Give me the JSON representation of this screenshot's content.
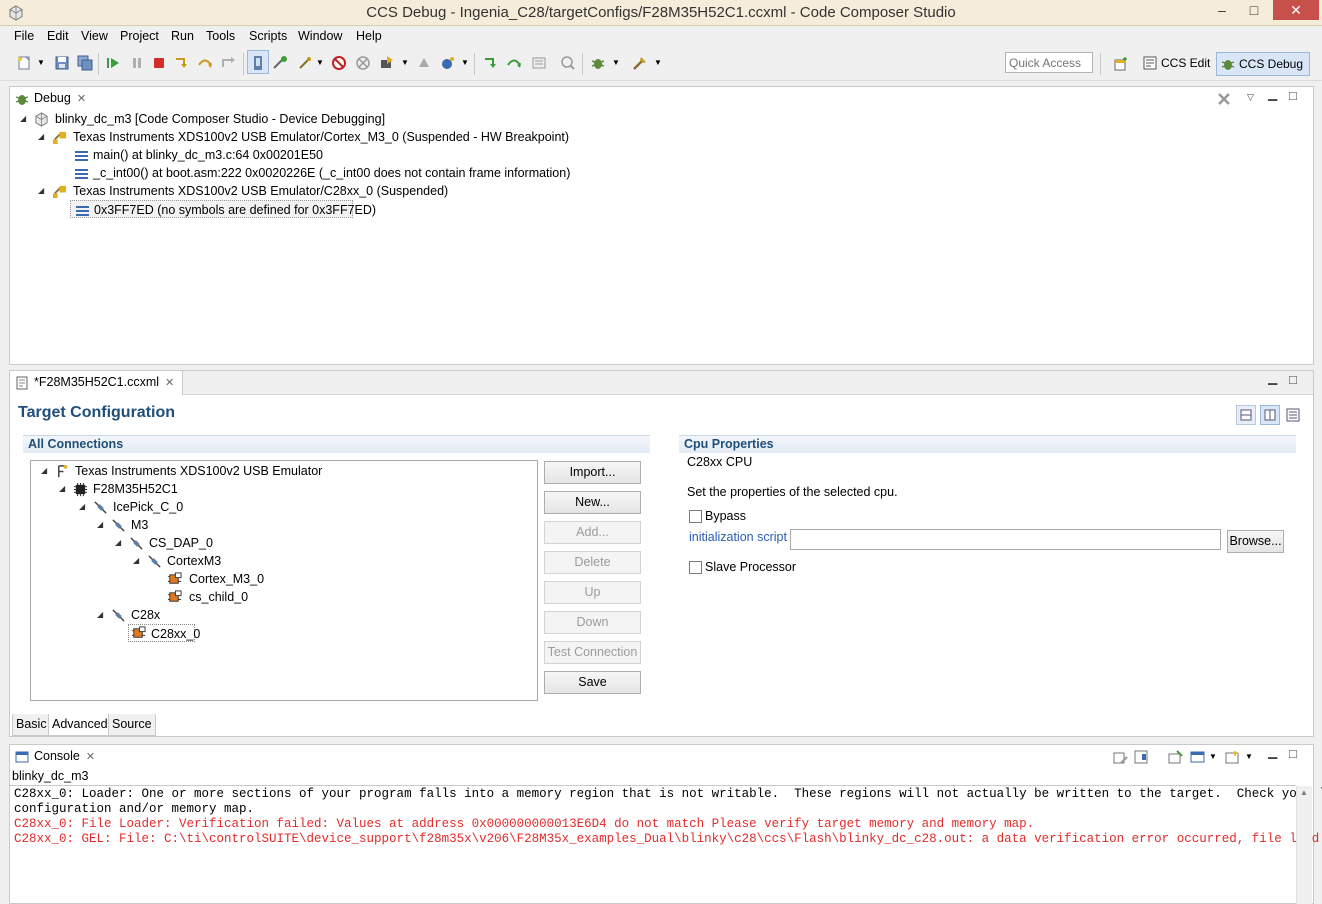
{
  "window": {
    "title": "CCS Debug - Ingenia_C28/targetConfigs/F28M35H52C1.ccxml - Code Composer Studio",
    "minimize": "–",
    "maximize": "□",
    "close": "✕"
  },
  "menu": [
    "File",
    "Edit",
    "View",
    "Project",
    "Run",
    "Tools",
    "Scripts",
    "Window",
    "Help"
  ],
  "toolbar": {
    "quick_access_placeholder": "Quick Access",
    "perspectives": [
      {
        "label": "CCS Edit",
        "active": false
      },
      {
        "label": "CCS Debug",
        "active": true
      }
    ]
  },
  "debug_view": {
    "tab_label": "Debug",
    "tree": [
      {
        "label": "blinky_dc_m3 [Code Composer Studio - Device Debugging]"
      },
      {
        "label": "Texas Instruments XDS100v2 USB Emulator/Cortex_M3_0 (Suspended - HW Breakpoint)"
      },
      {
        "label": "main() at blinky_dc_m3.c:64 0x00201E50"
      },
      {
        "label": "_c_int00() at boot.asm:222 0x0020226E  (_c_int00 does not contain frame information)"
      },
      {
        "label": "Texas Instruments XDS100v2 USB Emulator/C28xx_0 (Suspended)"
      },
      {
        "label": "0x3FF7ED  (no symbols are defined for 0x3FF7ED)"
      }
    ]
  },
  "editor": {
    "tab_label": "*F28M35H52C1.ccxml",
    "heading": "Target Configuration",
    "all_connections_label": "All Connections",
    "connection_tree": [
      {
        "label": "Texas Instruments XDS100v2 USB Emulator"
      },
      {
        "label": "F28M35H52C1"
      },
      {
        "label": "IcePick_C_0"
      },
      {
        "label": "M3"
      },
      {
        "label": "CS_DAP_0"
      },
      {
        "label": "CortexM3"
      },
      {
        "label": "Cortex_M3_0"
      },
      {
        "label": "cs_child_0"
      },
      {
        "label": "C28x"
      },
      {
        "label": "C28xx_0"
      }
    ],
    "buttons": {
      "import": "Import...",
      "new": "New...",
      "add": "Add...",
      "delete": "Delete",
      "up": "Up",
      "down": "Down",
      "test_connection": "Test Connection",
      "save": "Save"
    },
    "cpu_properties": {
      "heading": "Cpu Properties",
      "cpu_name": "C28xx CPU",
      "description": "Set the properties of the selected cpu.",
      "bypass_label": "Bypass",
      "init_script_label": "initialization script",
      "init_script_value": "",
      "browse_label": "Browse...",
      "slave_label": "Slave Processor"
    },
    "bottom_tabs": [
      "Basic",
      "Advanced",
      "Source"
    ]
  },
  "console_view": {
    "tab_label": "Console",
    "session": "blinky_dc_m3",
    "lines": [
      {
        "text": "C28xx_0: Loader: One or more sections of your program falls into a memory region that is not writable.  These regions will not actually be written to the target.  Check your linker",
        "error": false
      },
      {
        "text": "configuration and/or memory map.",
        "error": false
      },
      {
        "text": "C28xx_0: File Loader: Verification failed: Values at address 0x000000000013E6D4 do not match Please verify target memory and memory map.",
        "error": true
      },
      {
        "text": "C28xx_0: GEL: File: C:\\ti\\controlSUITE\\device_support\\f28m35x\\v206\\F28M35x_examples_Dual\\blinky\\c28\\ccs\\Flash\\blinky_dc_c28.out: a data verification error occurred, file load failed.",
        "error": true
      }
    ]
  },
  "colors": {
    "titlebar": "#f5ecd9",
    "close_button": "#c7504b",
    "heading_blue": "#1f4e79",
    "link_blue": "#2a5db0",
    "error_red": "#e32b2b"
  }
}
